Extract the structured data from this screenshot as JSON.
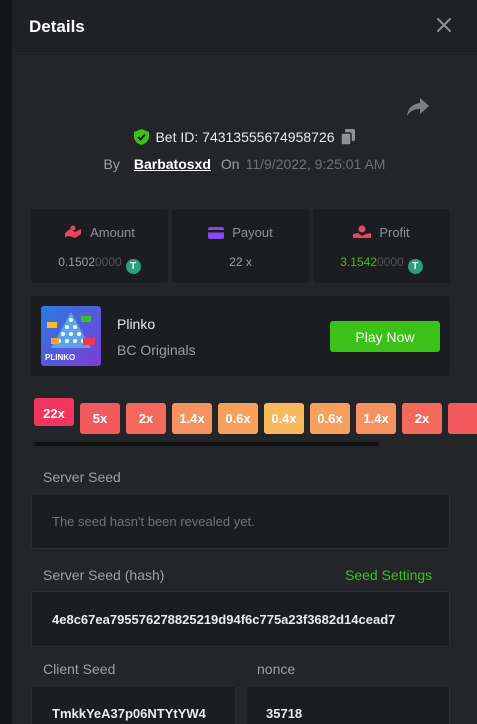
{
  "header": {
    "title": "Details"
  },
  "bet": {
    "prefix": "Bet ID:",
    "id": "74313555674958726",
    "by_label": "By",
    "user": "Barbatosxd",
    "on_label": "On",
    "date": "11/9/2022, 9:25:01 AM"
  },
  "stats": {
    "amount_label": "Amount",
    "amount_value": "0.1502",
    "amount_suffix": "0000",
    "payout_label": "Payout",
    "payout_value": "22 x",
    "profit_label": "Profit",
    "profit_value": "3.1542",
    "profit_suffix": "0000",
    "coin_symbol": "T"
  },
  "game": {
    "name": "Plinko",
    "provider": "BC Originals",
    "play_label": "Play Now",
    "thumb_text": "PLINKO"
  },
  "multipliers": [
    "22x",
    "5x",
    "2x",
    "1.4x",
    "0.6x",
    "0.4x",
    "0.6x",
    "1.4x",
    "2x",
    ""
  ],
  "multiplier_colors": [
    "#f0365e",
    "#f25a5e",
    "#f36a5d",
    "#f59260",
    "#f7a05e",
    "#f8b85c",
    "#f7a05e",
    "#f59260",
    "#f36a5d",
    "#f25a5e"
  ],
  "server_seed": {
    "label": "Server Seed",
    "value": "The seed hasn't been revealed yet."
  },
  "server_hash": {
    "label": "Server Seed (hash)",
    "link": "Seed Settings",
    "value": "4e8c67ea795576278825219d94f6c775a23f3682d14cead7"
  },
  "client_seed": {
    "label": "Client Seed",
    "value": "TmkkYeA37p06NTYtYW4"
  },
  "nonce": {
    "label": "nonce",
    "value": "35718"
  },
  "colors": {
    "accent": "#3bc117",
    "panel": "#1b1d20",
    "background": "#232528"
  }
}
